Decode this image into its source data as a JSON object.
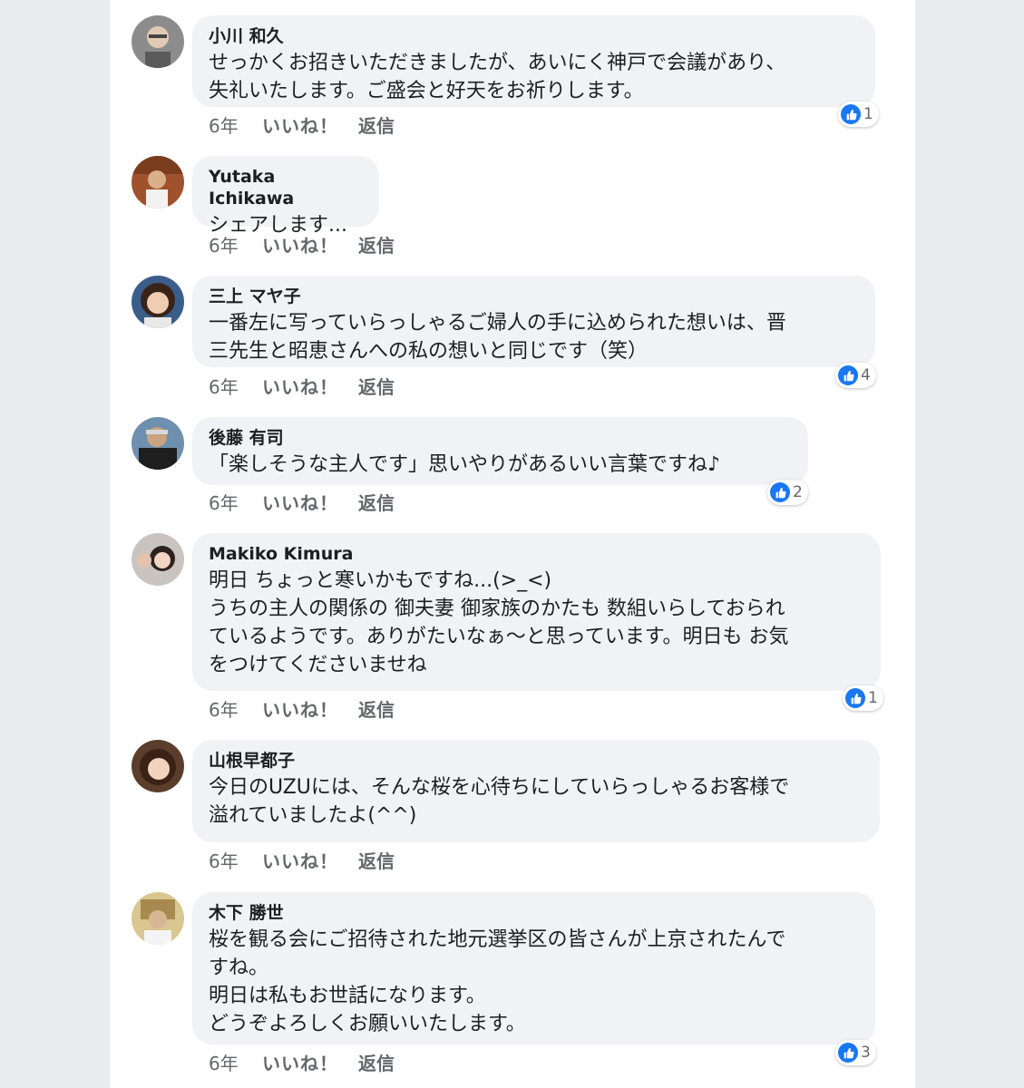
{
  "ui": {
    "like_label": "いいね！",
    "reply_label": "返信",
    "like_color": "#1877f2",
    "bubble_color": "#f0f2f5"
  },
  "comments": [
    {
      "name": "小川 和久",
      "text": "せっかくお招きいただきましたが、あいにく神戸で会議があり、\n失礼いたします。ご盛会と好天をお祈りします。",
      "age": "6年",
      "likes": "1"
    },
    {
      "name": "Yutaka Ichikawa",
      "text": "シェアします...",
      "age": "6年",
      "likes": ""
    },
    {
      "name": "三上 マヤ子",
      "text": "一番左に写っていらっしゃるご婦人の手に込められた想いは、晋\n三先生と昭恵さんへの私の想いと同じです（笑）",
      "age": "6年",
      "likes": "4"
    },
    {
      "name": "後藤 有司",
      "text": "「楽しそうな主人です」思いやりがあるいい言葉ですね♪",
      "age": "6年",
      "likes": "2"
    },
    {
      "name": "Makiko Kimura",
      "text": "明日 ちょっと寒いかもですね...(>_<)\nうちの主人の関係の 御夫妻 御家族のかたも 数組いらしておられ\nているようです。ありがたいなぁ〜と思っています。明日も お気\nをつけてくださいませね",
      "age": "6年",
      "likes": "1"
    },
    {
      "name": "山根早都子",
      "text": "今日のUZUには、そんな桜を心待ちにしていらっしゃるお客様で\n溢れていましたよ(^^)",
      "age": "6年",
      "likes": ""
    },
    {
      "name": "木下 勝世",
      "text": "桜を観る会にご招待された地元選挙区の皆さんが上京されたんで\nすね。\n明日は私もお世話になります。\nどうぞよろしくお願いいたします。",
      "age": "6年",
      "likes": "3"
    }
  ]
}
